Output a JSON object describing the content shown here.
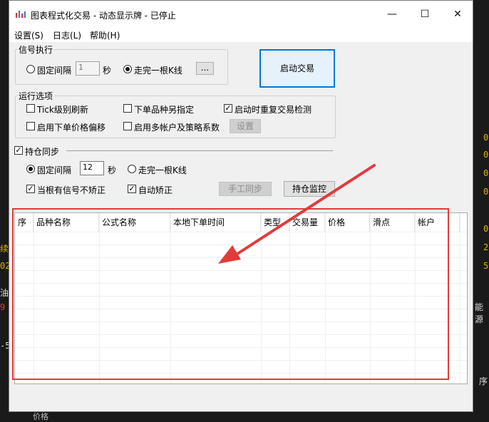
{
  "window": {
    "title": "图表程式化交易 - 动态显示牌 - 已停止",
    "minimize": "—",
    "maximize": "☐",
    "close": "✕"
  },
  "menu": [
    "设置(S)",
    "日志(L)",
    "帮助(H)"
  ],
  "signal": {
    "legend": "信号执行",
    "fixed_label": "固定间隔",
    "interval_value": "1",
    "seconds": "秒",
    "bar_label": "走完一根K线",
    "dots": "..."
  },
  "start_button": "启动交易",
  "run_options": {
    "legend": "运行选项",
    "tick_refresh": "Tick级别刷新",
    "order_symbol": "下单品种另指定",
    "restart_check": "启动时重复交易检测",
    "price_offset": "启用下单价格偏移",
    "multi_account": "启用多帐户及策略系数",
    "settings_btn": "设置"
  },
  "position_sync": {
    "label": "持仓同步",
    "fixed_label": "固定间隔",
    "interval_value": "12",
    "seconds": "秒",
    "bar_label": "走完一根K线",
    "no_correct": "当根有信号不矫正",
    "auto_correct": "自动矫正",
    "manual_sync": "手工同步",
    "monitor": "持仓监控"
  },
  "table": {
    "columns": [
      "序",
      "品种名称",
      "公式名称",
      "本地下单时间",
      "类型",
      "交易量",
      "价格",
      "滑点",
      "帐户"
    ]
  },
  "background": {
    "right": [
      "0",
      "0",
      "0",
      "0",
      "0",
      "2",
      "5",
      "能源",
      "序"
    ],
    "left": [
      "续",
      "02",
      "油",
      "9",
      "-5",
      "价格"
    ]
  },
  "colors": {
    "accent": "#0078d7",
    "highlight": "#e23b3b",
    "arrow": "#e23b3b"
  }
}
